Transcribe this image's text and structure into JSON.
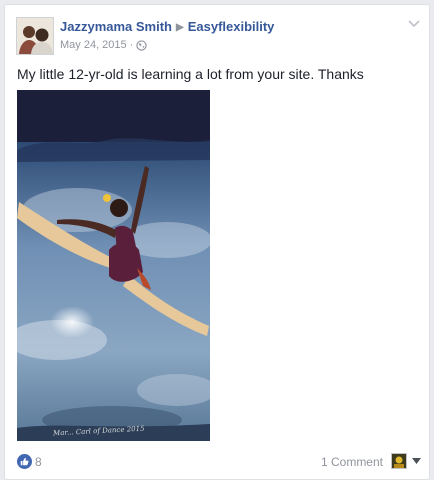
{
  "post": {
    "author": "Jazzymama Smith",
    "target_page": "Easyflexibility",
    "date": "May 24, 2015",
    "separator": "·",
    "audience_icon": "globe-icon",
    "text": "My little 12-yr-old is learning a lot from your site. Thanks",
    "photo_caption": "Mar... Carl of Dance 2015"
  },
  "footer": {
    "like_icon": "like-thumb-icon",
    "like_count": "8",
    "comments": "1 Comment"
  },
  "colors": {
    "link": "#365899",
    "meta": "#90949c",
    "text": "#1d2129",
    "like_blue": "#4267b2"
  }
}
